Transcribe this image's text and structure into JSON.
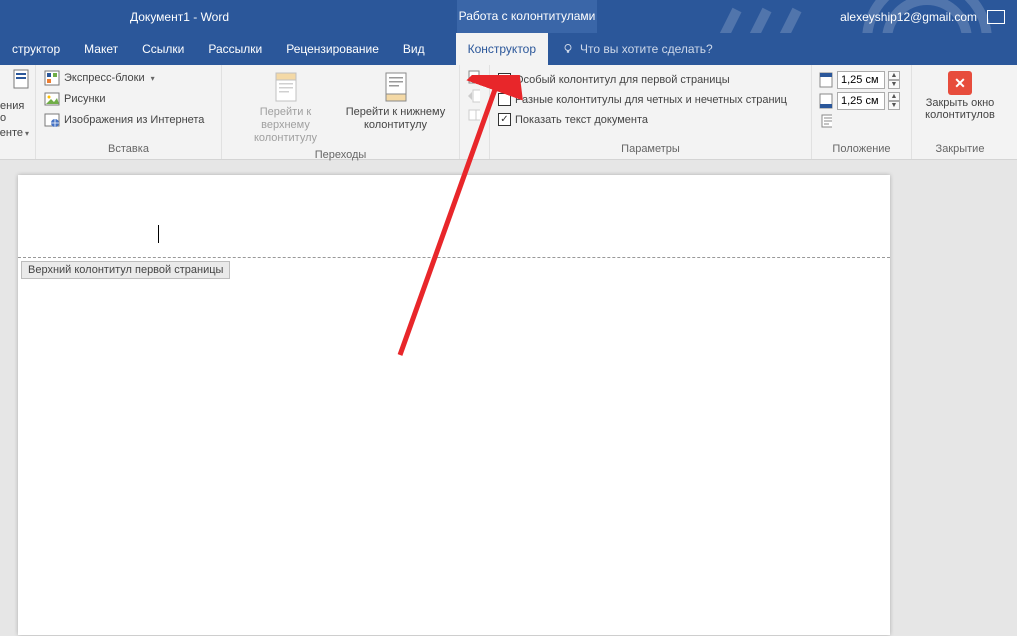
{
  "title": {
    "doc": "Документ1  -  Word",
    "context": "Работа с колонтитулами"
  },
  "user": {
    "email": "alexeyship12@gmail.com"
  },
  "tabs": {
    "t0": "структор",
    "t1": "Макет",
    "t2": "Ссылки",
    "t3": "Рассылки",
    "t4": "Рецензирование",
    "t5": "Вид",
    "t6": "Конструктор",
    "tellme": "Что вы хотите сделать?"
  },
  "ribbon": {
    "frag": {
      "line1": "ения о",
      "line2": "менте"
    },
    "insert": {
      "quickparts": "Экспресс-блоки",
      "pictures": "Рисунки",
      "online": "Изображения из Интернета",
      "label": "Вставка"
    },
    "nav": {
      "gotoHeader": "Перейти к верхнему колонтитулу",
      "gotoFooter": "Перейти к нижнему колонтитулу",
      "label": "Переходы"
    },
    "options": {
      "firstPage": "Особый колонтитул для первой страницы",
      "oddEven": "Разные колонтитулы для четных и нечетных страниц",
      "showDoc": "Показать текст документа",
      "label": "Параметры"
    },
    "position": {
      "top": "1,25 см",
      "bottom": "1,25 см",
      "label": "Положение"
    },
    "close": {
      "btn": "Закрыть окно колонтитулов",
      "label": "Закрытие"
    }
  },
  "page": {
    "headerTag": "Верхний колонтитул первой страницы"
  }
}
